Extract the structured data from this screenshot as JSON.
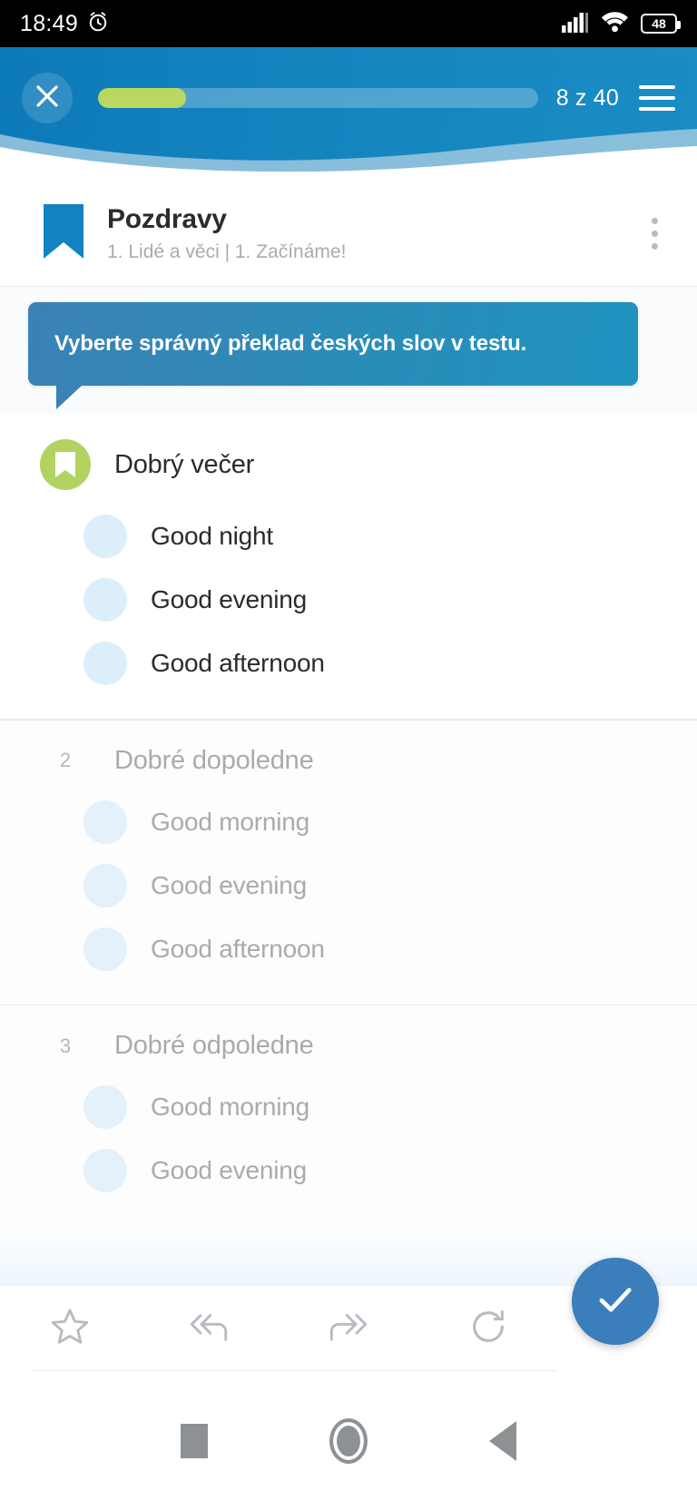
{
  "status_bar": {
    "time": "18:49",
    "alarm_icon": "alarm-clock-icon",
    "signal_icon": "cellular-signal-icon",
    "wifi_icon": "wifi-icon",
    "battery_level": "48"
  },
  "header": {
    "close_icon": "close-icon",
    "progress_percent": 20,
    "counter": "8 z 40",
    "menu_icon": "hamburger-menu-icon",
    "bg_color": "#1484bf",
    "progress_color": "#bad761"
  },
  "lesson": {
    "bookmark_icon": "bookmark-icon",
    "title": "Pozdravy",
    "subtitle": "1. Lidé a věci | 1. Začínáme!",
    "menu_icon": "kebab-menu-icon"
  },
  "instruction": {
    "text": "Vyberte správný překlad českých slov v testu.",
    "bg_color": "#2a8cb8"
  },
  "questions": [
    {
      "marker": "bookmark-badge",
      "marker_color": "#b3d361",
      "prompt": "Dobrý večer",
      "active": true,
      "options": [
        "Good night",
        "Good evening",
        "Good afternoon"
      ]
    },
    {
      "marker": "2",
      "prompt": "Dobré dopoledne",
      "active": false,
      "options": [
        "Good morning",
        "Good evening",
        "Good afternoon"
      ]
    },
    {
      "marker": "3",
      "prompt": "Dobré odpoledne",
      "active": false,
      "options": [
        "Good morning",
        "Good evening"
      ]
    }
  ],
  "toolbar": {
    "items": [
      {
        "icon": "star-icon",
        "label": "Favorite"
      },
      {
        "icon": "reply-all-back-icon",
        "label": "Previous"
      },
      {
        "icon": "forward-skip-icon",
        "label": "Skip"
      },
      {
        "icon": "refresh-redo-icon",
        "label": "Restart"
      }
    ],
    "submit_icon": "check-icon",
    "submit_color": "#3a7ebc"
  },
  "android_nav": {
    "recents_icon": "square-recents-icon",
    "home_icon": "circle-home-icon",
    "back_icon": "triangle-back-icon"
  }
}
